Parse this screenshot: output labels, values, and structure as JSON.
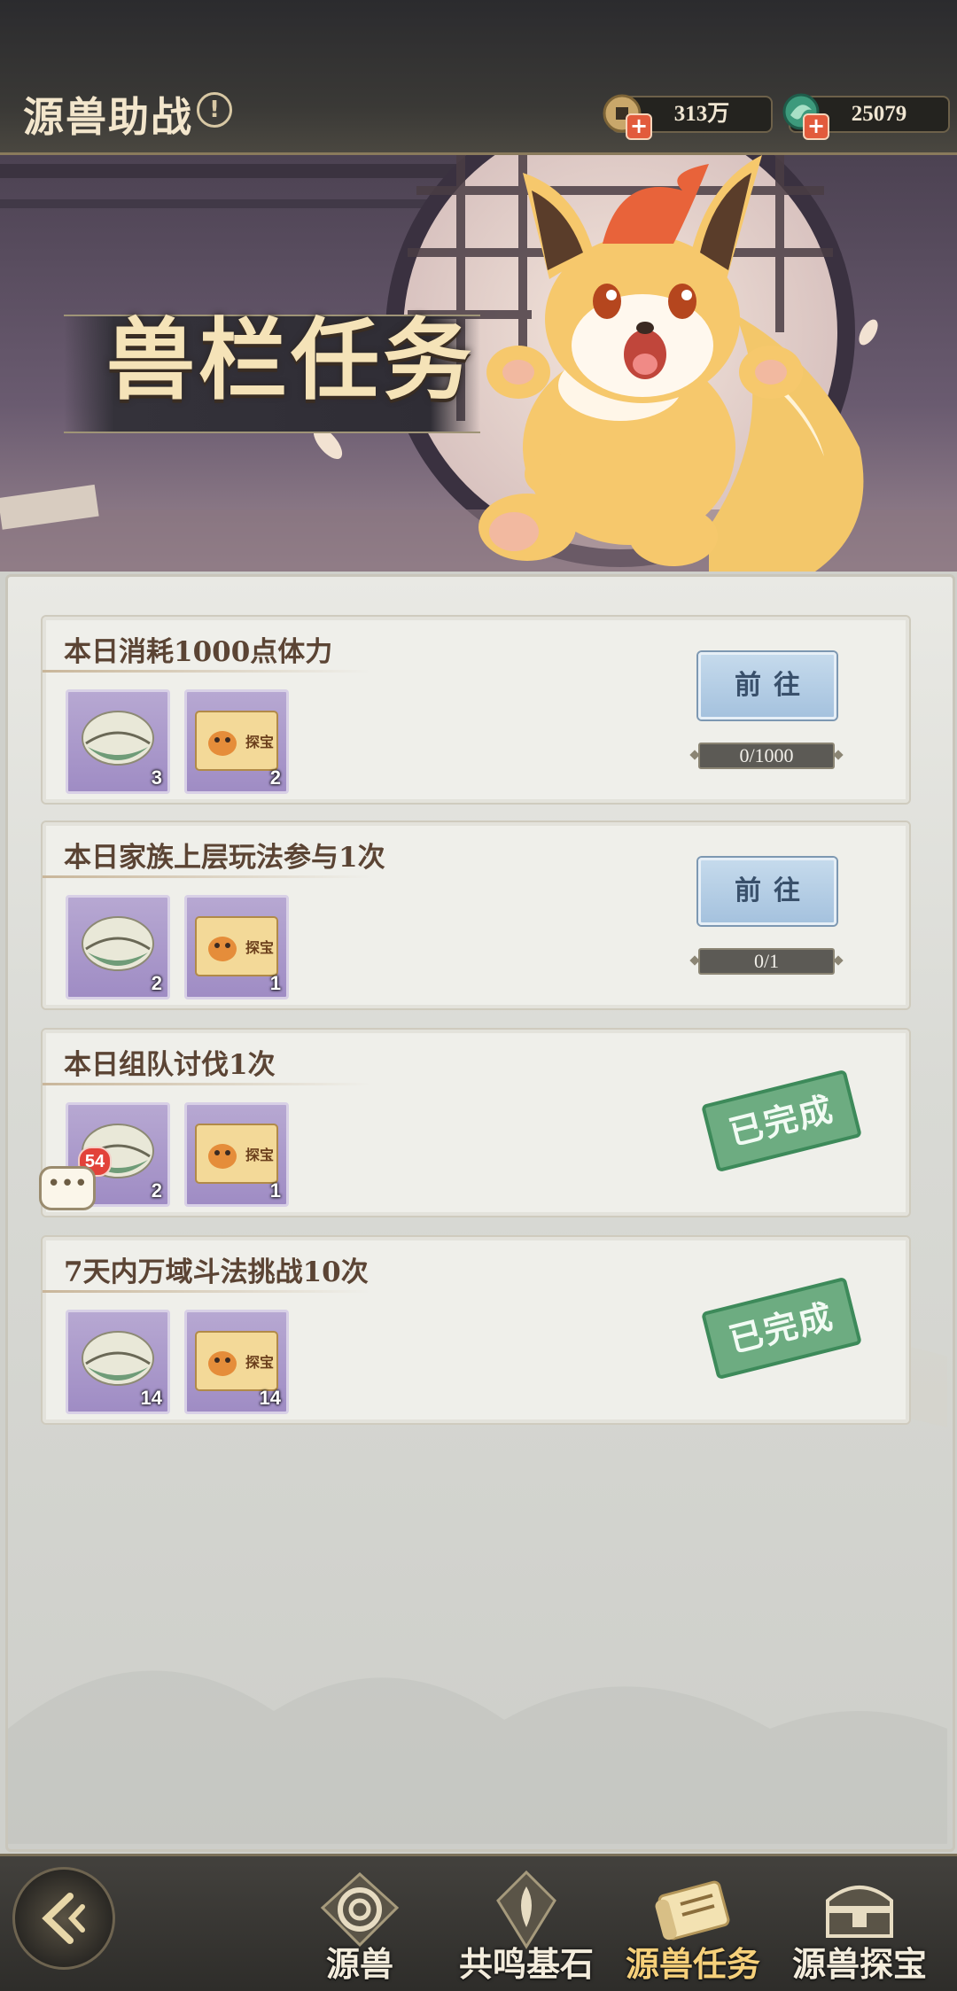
{
  "header": {
    "title": "源兽助战",
    "info_icon": "info-icon",
    "currencies": [
      {
        "icon": "copper-coin-icon",
        "value": "313万"
      },
      {
        "icon": "jade-dragon-icon",
        "value": "25079"
      }
    ]
  },
  "banner": {
    "title": "兽栏任务",
    "mascot": "fox-spirit-mascot"
  },
  "tasks": [
    {
      "title": "本日消耗1000点体力",
      "rewards": [
        {
          "icon": "shell-icon",
          "count": "3"
        },
        {
          "icon": "treasure-ticket-icon",
          "count": "2"
        }
      ],
      "status": "in_progress",
      "button_label": "前往",
      "progress": "0/1000"
    },
    {
      "title": "本日家族上层玩法参与1次",
      "rewards": [
        {
          "icon": "shell-icon",
          "count": "2"
        },
        {
          "icon": "treasure-ticket-icon",
          "count": "1"
        }
      ],
      "status": "in_progress",
      "button_label": "前往",
      "progress": "0/1"
    },
    {
      "title": "本日组队讨伐1次",
      "rewards": [
        {
          "icon": "shell-icon",
          "count": "2"
        },
        {
          "icon": "treasure-ticket-icon",
          "count": "1"
        }
      ],
      "status": "completed",
      "stamp_label": "已完成"
    },
    {
      "title": "7天内万域斗法挑战10次",
      "rewards": [
        {
          "icon": "shell-icon",
          "count": "14"
        },
        {
          "icon": "treasure-ticket-icon",
          "count": "14"
        }
      ],
      "status": "completed",
      "stamp_label": "已完成"
    }
  ],
  "ticket_text": "探宝",
  "chat": {
    "unread_badge": "54",
    "icon": "chat-bubble-icon"
  },
  "nav": {
    "back_icon": "back-arrow-icon",
    "tabs": [
      {
        "label": "源兽",
        "icon": "swirl-beast-icon",
        "active": false
      },
      {
        "label": "共鸣基石",
        "icon": "resonance-stone-icon",
        "active": false
      },
      {
        "label": "源兽任务",
        "icon": "task-scroll-icon",
        "active": true
      },
      {
        "label": "源兽探宝",
        "icon": "treasure-chest-icon",
        "active": false
      }
    ]
  },
  "colors": {
    "title_text": "#5b4434",
    "go_button": "#a5c2de",
    "completed_stamp": "#3d8a5a",
    "badge": "#e2423a",
    "active_tab": "#f6d07a"
  }
}
